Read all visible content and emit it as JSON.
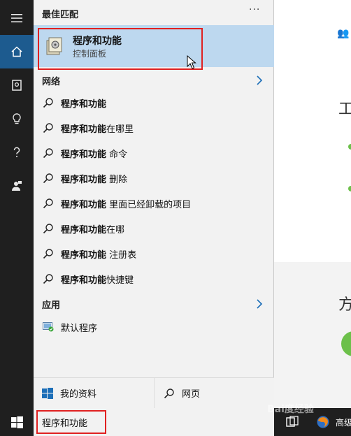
{
  "taskbar": {
    "search_text": "程序和功能",
    "tray_text": "高级"
  },
  "panel": {
    "best_match_header": "最佳匹配",
    "more_label": "···",
    "best_match": {
      "title": "程序和功能",
      "subtitle": "控制面板"
    },
    "web_header": "网络",
    "web_results": [
      {
        "bold": "程序和功能",
        "rest": ""
      },
      {
        "bold": "程序和功能",
        "rest": "在哪里"
      },
      {
        "bold": "程序和功能",
        "rest": " 命令"
      },
      {
        "bold": "程序和功能",
        "rest": " 删除"
      },
      {
        "bold": "程序和功能",
        "rest": " 里面已经卸载的项目"
      },
      {
        "bold": "程序和功能",
        "rest": "在哪"
      },
      {
        "bold": "程序和功能",
        "rest": " 注册表"
      },
      {
        "bold": "程序和功能",
        "rest": "快捷键"
      }
    ],
    "apps_header": "应用",
    "app_result": "默认程序",
    "bottom": {
      "my_stuff": "我的资料",
      "web": "网页"
    }
  },
  "background": {
    "heading1": "工",
    "heading2": "方"
  },
  "watermark": "Bai度经验",
  "colors": {
    "accent": "#1d5b8f",
    "selection": "#bdd8ef",
    "highlight_box": "#e02020"
  }
}
